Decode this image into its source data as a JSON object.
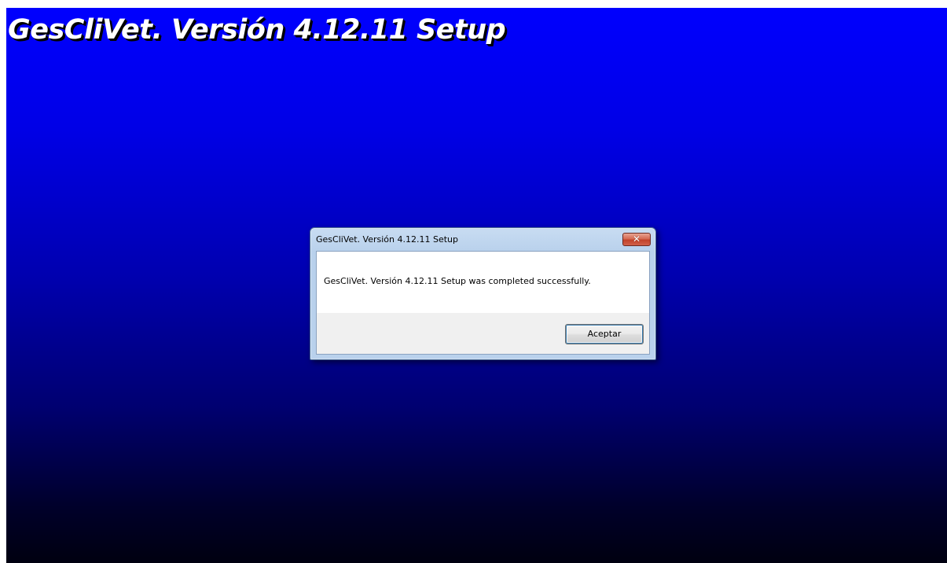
{
  "background": {
    "title": "GesCliVet. Versión 4.12.11 Setup",
    "colors": {
      "gradient_top": "#0000fe",
      "gradient_bottom": "#000010",
      "title_text": "#ffffff",
      "title_shadow": "#000000"
    }
  },
  "dialog": {
    "title": "GesCliVet. Versión 4.12.11 Setup",
    "close_icon": "close-icon",
    "close_glyph": "✕",
    "message": "GesCliVet. Versión 4.12.11 Setup was completed successfully.",
    "ok_button_label": "Aceptar",
    "colors": {
      "close_button": "#c2422a",
      "focus_ring": "#3c7fb1"
    }
  }
}
